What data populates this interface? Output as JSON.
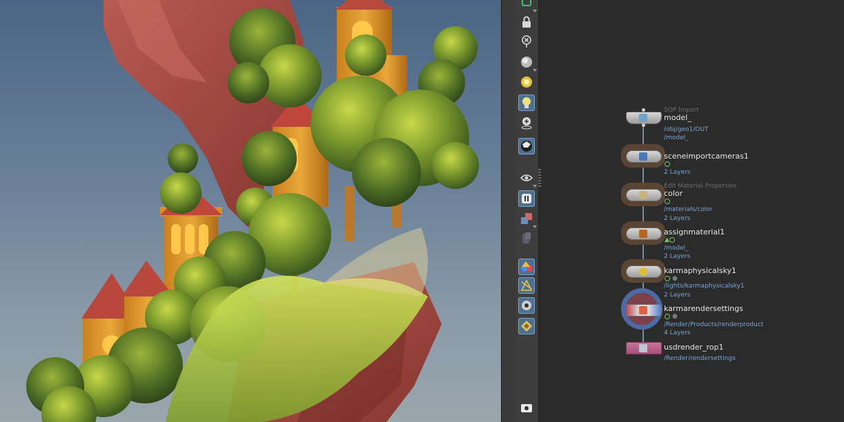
{
  "toolbar": {
    "icons": [
      "network-flag-icon",
      "lock-icon",
      "close-pin-icon",
      "shading-icon",
      "headlight-icon",
      "light-bulb-icon",
      "light-add-icon",
      "camera-ball-icon",
      "eye-visibility-icon",
      "pause-render-icon",
      "render-region-icon",
      "display-options-icon",
      "karma-shapes-icon",
      "bounding-icon",
      "snapshot-icon",
      "layer-stack-icon",
      "visibility-eye-icon"
    ]
  },
  "network": {
    "nodes": [
      {
        "context": "SOP Import",
        "name": "model_",
        "path1": "/obj/geo1/OUT",
        "path2": "/model_",
        "layers": ""
      },
      {
        "context": "",
        "name": "sceneimportcameras1",
        "path1": "",
        "path2": "",
        "layers": "2 Layers"
      },
      {
        "context": "Edit Material Properties",
        "name": "color",
        "path1": "/materials/color",
        "path2": "",
        "layers": "2 Layers"
      },
      {
        "context": "",
        "name": "assignmaterial1",
        "path1": "/model_",
        "path2": "",
        "layers": "2 Layers"
      },
      {
        "context": "",
        "name": "karmaphysicalsky1",
        "path1": "/lights/karmaphysicalsky1",
        "path2": "",
        "layers": "2 Layers"
      },
      {
        "context": "",
        "name": "karmarendersettings",
        "path1": "/Render/Products/renderproduct",
        "path2": "",
        "layers": "4 Layers"
      },
      {
        "context": "",
        "name": "usdrender_rop1",
        "path1": "/Render/rendersettings",
        "path2": "",
        "layers": ""
      }
    ]
  },
  "colors": {
    "accent": "#4e6f8e",
    "path_text": "#78a6d8",
    "rop_node": "#c7739a",
    "selection_ring": "#4d6aa3"
  }
}
